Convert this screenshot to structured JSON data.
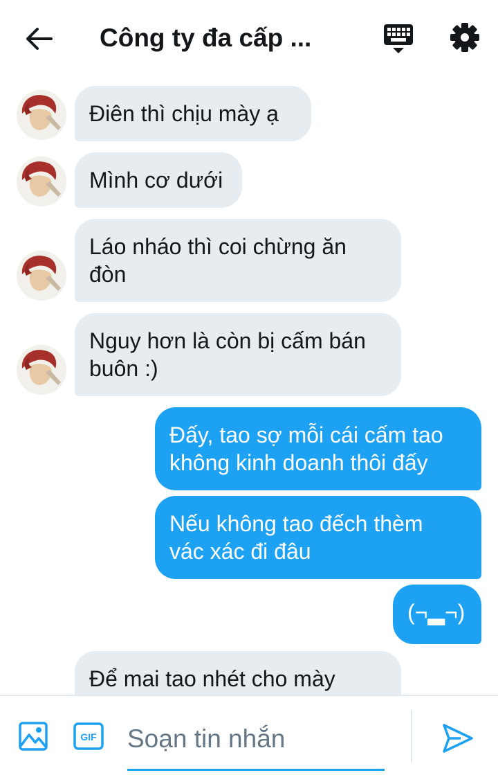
{
  "header": {
    "title": "Công ty đa cấp ...",
    "icons": {
      "back": "arrow-left-icon",
      "keyboard": "keyboard-icon",
      "settings": "gear-icon"
    }
  },
  "messages": [
    {
      "dir": "in",
      "text": "Điên thì chịu mày ạ",
      "avatar": true
    },
    {
      "dir": "in",
      "text": "Mình cơ dưới",
      "avatar": true
    },
    {
      "dir": "in",
      "text": "Láo nháo thì coi chừng ăn\nđòn",
      "avatar": true
    },
    {
      "dir": "in",
      "text": "Nguy hơn là còn bị cấm bán\nbuôn :)",
      "avatar": true
    },
    {
      "dir": "out",
      "text": "Đấy, tao sợ mỗi cái cấm tao\nkhông kinh doanh thôi đấy"
    },
    {
      "dir": "out",
      "text": "Nếu không tao đếch thèm\nvác xác đi đâu"
    },
    {
      "dir": "out",
      "text": "(¬▂¬)"
    },
    {
      "dir": "in",
      "text": "Để mai tao nhét cho mày",
      "avatar": false
    }
  ],
  "composer": {
    "placeholder": "Soạn tin nhắn",
    "gif_label": "GIF",
    "icons": {
      "image": "image-icon",
      "gif": "gif-icon",
      "send": "send-icon"
    }
  },
  "colors": {
    "accent": "#1da1f2",
    "incoming_bubble": "#e6ecf0",
    "text": "#14171a",
    "placeholder": "#657786"
  }
}
